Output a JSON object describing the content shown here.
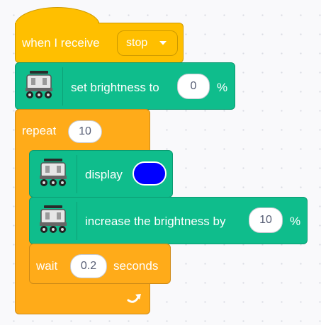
{
  "event": {
    "label": "when I receive",
    "message": "stop"
  },
  "set_brightness": {
    "label": "set brightness to",
    "value": "0",
    "unit": "%"
  },
  "repeat": {
    "label": "repeat",
    "count": "10"
  },
  "display": {
    "label": "display",
    "color": "#0000ff"
  },
  "increase": {
    "label": "increase the brightness by",
    "value": "10",
    "unit": "%"
  },
  "wait": {
    "label": "wait",
    "value": "0.2",
    "unit": "seconds"
  },
  "colors": {
    "events": "#ffbf00",
    "extension": "#0fbd8c",
    "control": "#ffab19"
  },
  "icons": {
    "robot": "robot-car-icon",
    "dropdown": "chevron-down-icon",
    "loop": "loop-arrow-icon"
  }
}
